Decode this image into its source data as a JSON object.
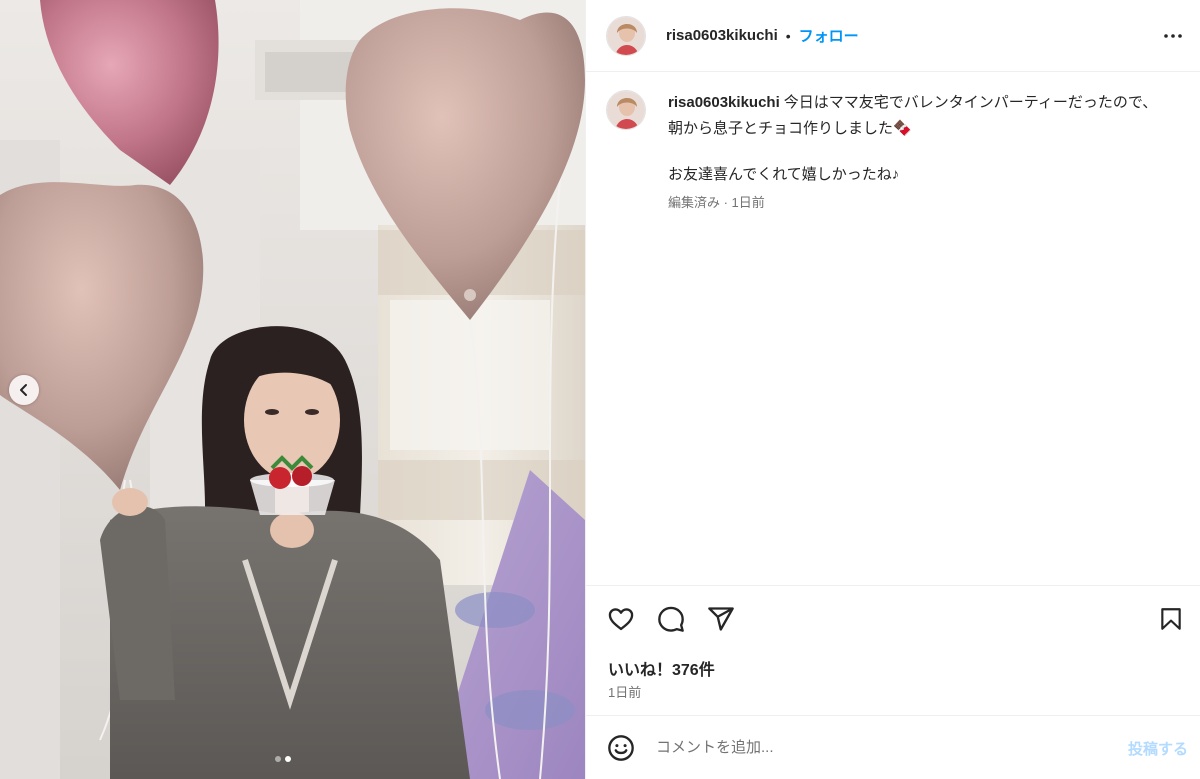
{
  "post": {
    "author": {
      "username": "risa0603kikuchi",
      "separator": "•",
      "follow_label": "フォロー"
    },
    "caption": {
      "username": "risa0603kikuchi",
      "line1": "今日はママ友宅でバレンタインパーティーだったので、朝から息子とチョコ作りしました🍫",
      "line2": "お友達喜んでくれて嬉しかったね♪",
      "meta": "編集済み · 1日前"
    },
    "engagement": {
      "likes_label": "いいね！376件",
      "date": "1日前"
    },
    "composer": {
      "placeholder": "コメントを追加...",
      "post_label": "投稿する"
    },
    "carousel": {
      "slide_count": 2,
      "current_slide": 2
    }
  },
  "colors": {
    "accent": "#0095f6",
    "post_disabled": "#b3dbff",
    "text": "#262626",
    "secondary_text": "#737373",
    "divider": "#efefef"
  },
  "icons": {
    "prev": "chevron-left-icon",
    "more": "more-horizontal-icon",
    "like": "heart-icon",
    "comment": "comment-icon",
    "share": "share-paper-plane-icon",
    "save": "bookmark-icon",
    "emoji": "smiley-icon"
  }
}
